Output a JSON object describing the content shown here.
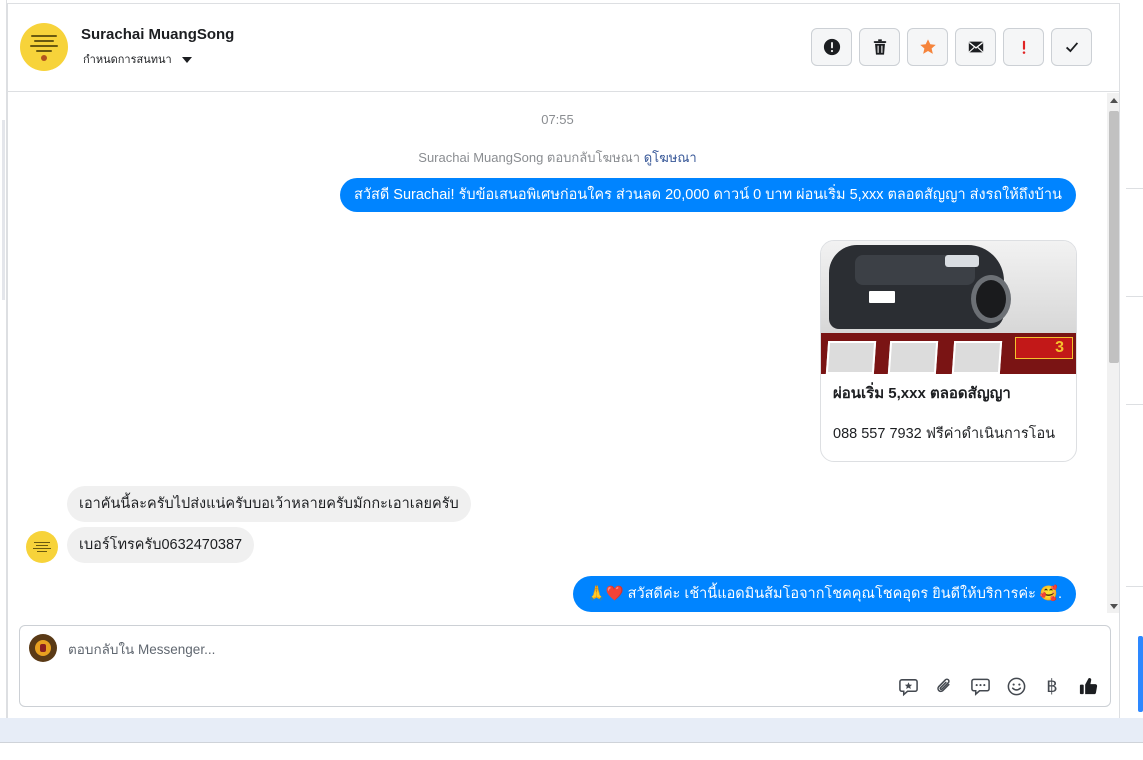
{
  "header": {
    "contact_name": "Surachai MuangSong",
    "assign_label": "กำหนดการสนทนา",
    "actions": [
      {
        "name": "spam-button",
        "icon": "alert-circle-icon"
      },
      {
        "name": "delete-button",
        "icon": "trash-icon"
      },
      {
        "name": "star-button",
        "icon": "star-icon"
      },
      {
        "name": "mark-unread-button",
        "icon": "envelope-icon"
      },
      {
        "name": "follow-up-button",
        "icon": "exclamation-icon"
      },
      {
        "name": "mark-done-button",
        "icon": "checkmark-icon"
      }
    ]
  },
  "thread": {
    "time": "07:55",
    "reply_note": "Surachai MuangSong ตอบกลับโฆษณา",
    "reply_link": "ดูโฆษณา",
    "outgoing_1": "สวัสดี Surachai! รับข้อเสนอพิเศษก่อนใคร ส่วนลด 20,000 ดาวน์ 0 บาท ผ่อนเริ่ม 5,xxx ตลอดสัญญา ส่งรถให้ถึงบ้าน",
    "card": {
      "title": "ผ่อนเริ่ม 5,xxx ตลอดสัญญา",
      "subtitle": "088 557 7932 ฟรีค่าดำเนินการโอน",
      "badge_number": "3"
    },
    "incoming_1": "เอาคันนี้ละครับไปส่งแน่ครับบอเว้าหลายครับมักกะเอาเลยครับ",
    "incoming_2": "เบอร์โทรครับ0632470387",
    "outgoing_2": "🙏❤️ สวัสดีค่ะ เช้านี้แอดมินส้มโอจากโชคคุณโชคอุดร ยินดีให้บริการค่ะ 🥰."
  },
  "composer": {
    "placeholder": "ตอบกลับใน Messenger...",
    "tools": [
      "saved-reply-icon",
      "paperclip-icon",
      "speech-bubble-icon",
      "emoji-icon",
      "baht-icon",
      "thumbs-up-icon"
    ]
  },
  "colors": {
    "brand_blue": "#0084ff",
    "link_blue": "#385898",
    "star_orange": "#f5843c",
    "alert_red": "#e02424"
  }
}
